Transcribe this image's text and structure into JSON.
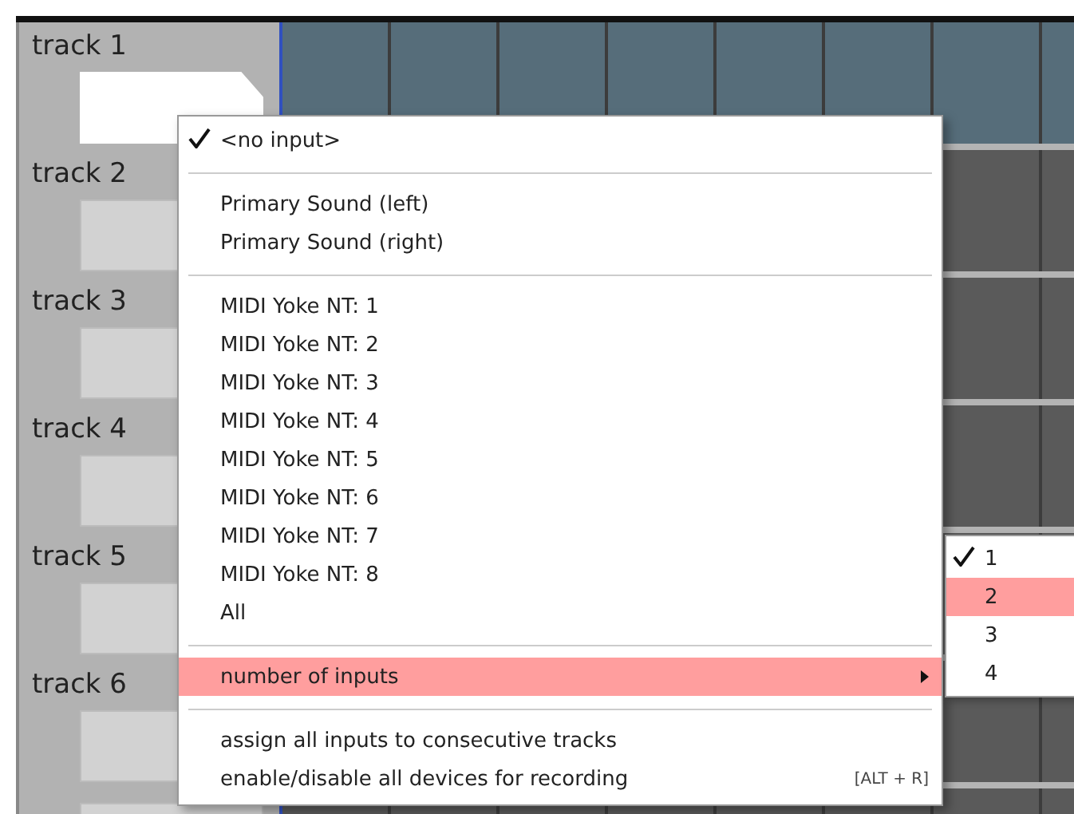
{
  "tracks": [
    {
      "name": "track 1",
      "selected": true
    },
    {
      "name": "track 2",
      "selected": false
    },
    {
      "name": "track 3",
      "selected": false
    },
    {
      "name": "track 4",
      "selected": false
    },
    {
      "name": "track 5",
      "selected": false
    },
    {
      "name": "track 6",
      "selected": false
    },
    {
      "selected": false
    }
  ],
  "menu": {
    "groups": [
      [
        {
          "label": "<no input>",
          "checked": true,
          "selected": false
        }
      ],
      [
        {
          "label": "Primary Sound (left)",
          "checked": false,
          "selected": false
        },
        {
          "label": "Primary Sound (right)",
          "checked": false,
          "selected": false
        }
      ],
      [
        {
          "label": "MIDI Yoke NT:  1",
          "checked": false,
          "selected": false
        },
        {
          "label": "MIDI Yoke NT:  2",
          "checked": false,
          "selected": false
        },
        {
          "label": "MIDI Yoke NT:  3",
          "checked": false,
          "selected": false
        },
        {
          "label": "MIDI Yoke NT:  4",
          "checked": false,
          "selected": false
        },
        {
          "label": "MIDI Yoke NT:  5",
          "checked": false,
          "selected": false
        },
        {
          "label": "MIDI Yoke NT:  6",
          "checked": false,
          "selected": false
        },
        {
          "label": "MIDI Yoke NT:  7",
          "checked": false,
          "selected": false
        },
        {
          "label": "MIDI Yoke NT:  8",
          "checked": false,
          "selected": false
        },
        {
          "label": "All",
          "checked": false,
          "selected": false
        }
      ],
      [
        {
          "label": "number of inputs",
          "checked": false,
          "selected": true,
          "submenu": true
        }
      ],
      [
        {
          "label": "assign all inputs to consecutive tracks",
          "checked": false,
          "selected": false
        },
        {
          "label": "enable/disable all devices for recording",
          "checked": false,
          "selected": false,
          "shortcut": "[ALT + R]"
        }
      ]
    ]
  },
  "submenu": {
    "items": [
      {
        "label": "1",
        "checked": true,
        "selected": false
      },
      {
        "label": "2",
        "checked": false,
        "selected": true
      },
      {
        "label": "3",
        "checked": false,
        "selected": false
      },
      {
        "label": "4",
        "checked": false,
        "selected": false
      }
    ]
  }
}
